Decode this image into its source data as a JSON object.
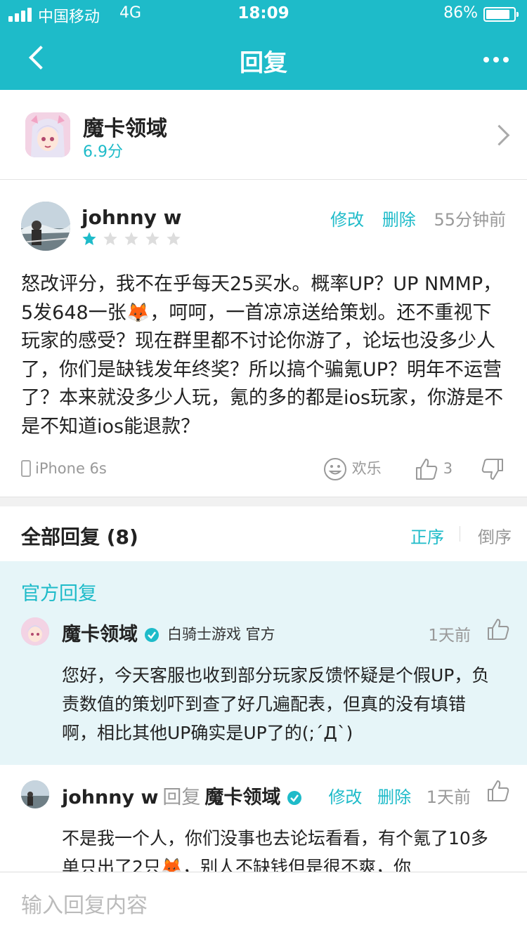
{
  "status_bar": {
    "carrier": "中国移动",
    "network": "4G",
    "time": "18:09",
    "battery_pct": "86%",
    "battery_level": 0.86
  },
  "header": {
    "title": "回复"
  },
  "game": {
    "name": "魔卡领域",
    "score": "6.9分"
  },
  "review": {
    "user": "johnny w",
    "rating": 1,
    "rating_max": 5,
    "edit": "修改",
    "delete": "删除",
    "time": "55分钟前",
    "text_parts": [
      "怒改评分，我不在乎每天25买水。概率UP？UP NMMP，5发648一张",
      "，呵呵，一首凉凉送给策划。还不重视下玩家的感受？现在群里都不讨论你游了，论坛也没多少人了，你们是缺钱发年终奖？所以搞个骗氪UP？明年不运营了？本来就没多少人玩，氪的多的都是ios玩家，你游是不是不知道ios能退款？"
    ],
    "emoji": "🦊",
    "device": "iPhone 6s",
    "fun_label": "欢乐",
    "like_count": "3"
  },
  "replies_header": {
    "title": "全部回复 (8)",
    "sort_asc": "正序",
    "sort_desc": "倒序"
  },
  "official": {
    "label": "官方回复",
    "name": "魔卡领域",
    "sub": "白骑士游戏 官方",
    "time": "1天前",
    "text": "您好，今天客服也收到部分玩家反馈怀疑是个假UP，负责数值的策划吓到查了好几遍配表，但真的没有填错啊，相比其他UP确实是UP了的(;´Д`)"
  },
  "user_reply": {
    "name": "johnny w",
    "reply_word": "回复",
    "target": "魔卡领域",
    "edit": "修改",
    "delete": "删除",
    "time": "1天前",
    "text_parts": [
      "不是我一个人，你们没事也去论坛看看，有个氪了10多单只出了2只",
      "，别人不缺钱但是很不爽，你"
    ],
    "emoji": "🦊"
  },
  "input": {
    "placeholder": "输入回复内容"
  },
  "colors": {
    "accent": "#1ebbc9",
    "star_on": "#1ebbc9",
    "star_off": "#dddddd",
    "official_bg": "#e6f5f8"
  }
}
